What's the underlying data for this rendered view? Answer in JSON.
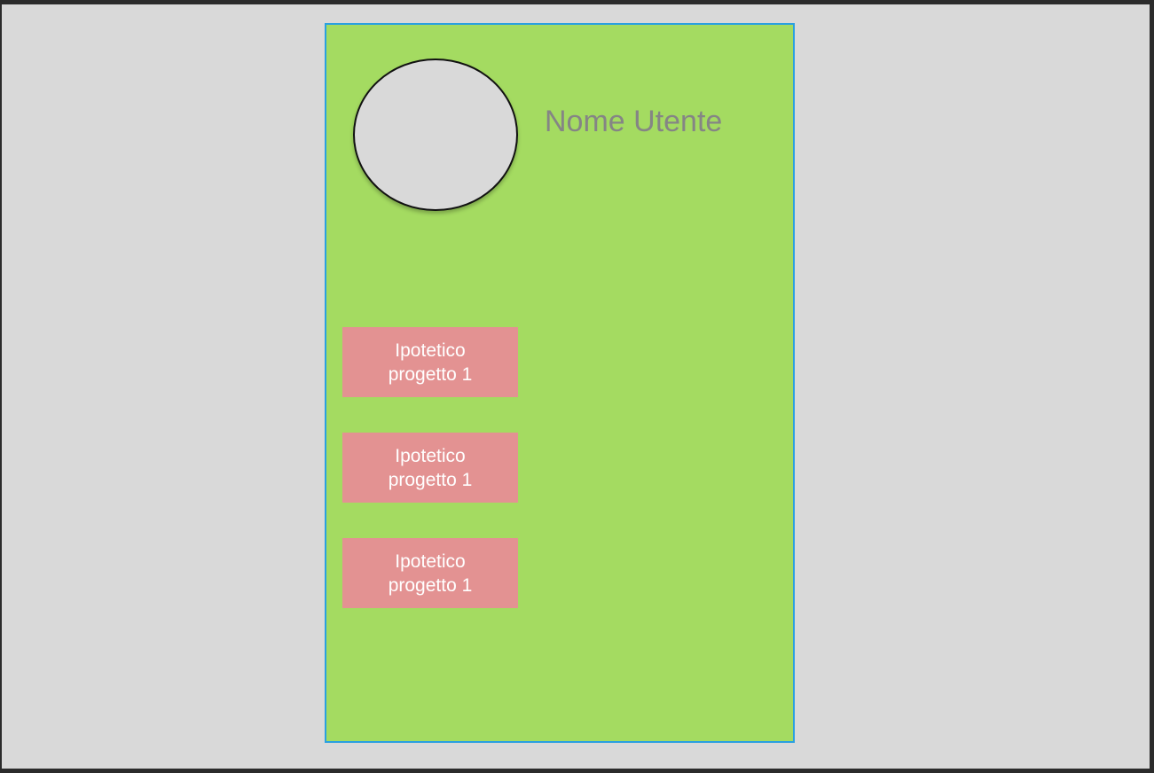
{
  "profile": {
    "username": "Nome Utente"
  },
  "projects": [
    {
      "label": "Ipotetico\nprogetto 1"
    },
    {
      "label": "Ipotetico\nprogetto 1"
    },
    {
      "label": "Ipotetico\nprogetto 1"
    }
  ],
  "colors": {
    "canvas_background": "#d9d9d9",
    "frame_background": "#a4db61",
    "frame_border": "#2aa0e0",
    "project_card": "#e39292",
    "username_text": "#858585"
  }
}
